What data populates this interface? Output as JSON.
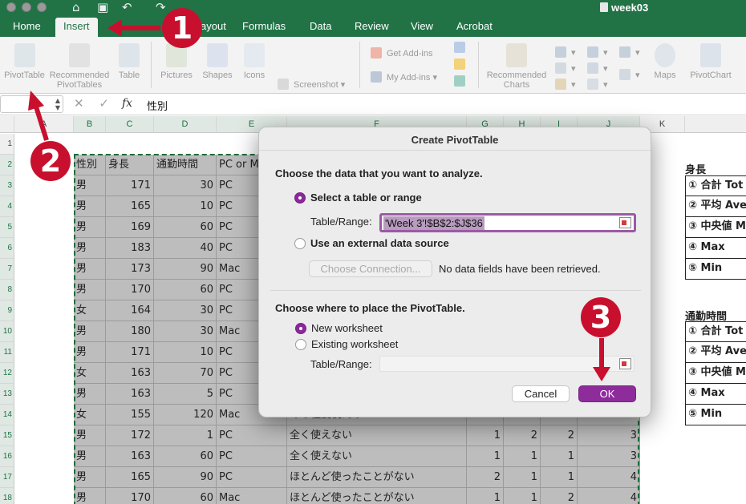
{
  "window": {
    "doc_title": "week03"
  },
  "tabs": [
    {
      "label": "Home",
      "active": false
    },
    {
      "label": "Insert",
      "active": true
    },
    {
      "label": "ayout",
      "active": false
    },
    {
      "label": "Formulas",
      "active": false
    },
    {
      "label": "Data",
      "active": false
    },
    {
      "label": "Review",
      "active": false
    },
    {
      "label": "View",
      "active": false
    },
    {
      "label": "Acrobat",
      "active": false
    }
  ],
  "ribbon": {
    "pivottable": "PivotTable",
    "recommended1": "Recommended",
    "recommended2": "PivotTables",
    "table": "Table",
    "pictures": "Pictures",
    "shapes": "Shapes",
    "icons": "Icons",
    "screenshot": "Screenshot",
    "get_addins": "Get Add-ins",
    "my_addins": "My Add-ins",
    "rec_charts1": "Recommended",
    "rec_charts2": "Charts",
    "maps": "Maps",
    "pivotchart": "PivotChart"
  },
  "formula_bar": {
    "fx": "fx",
    "value": "性別"
  },
  "columns": [
    "B",
    "C",
    "D",
    "E",
    "F",
    "G",
    "H",
    "I",
    "J",
    "K"
  ],
  "extra_col": "A",
  "rows": [
    "1",
    "2",
    "3",
    "4",
    "5",
    "6",
    "7",
    "8",
    "9",
    "10",
    "11",
    "12",
    "13",
    "14",
    "15",
    "16",
    "17",
    "18"
  ],
  "headers": {
    "b": "性別",
    "c": "身長",
    "d": "通勤時間",
    "e": "PC or M"
  },
  "data_rows": [
    {
      "b": "男",
      "c": "171",
      "d": "30",
      "e": "PC",
      "f": "",
      "g": "",
      "h": "",
      "i": "",
      "j": ""
    },
    {
      "b": "男",
      "c": "165",
      "d": "10",
      "e": "PC",
      "f": "",
      "g": "",
      "h": "",
      "i": "",
      "j": ""
    },
    {
      "b": "男",
      "c": "169",
      "d": "60",
      "e": "PC",
      "f": "",
      "g": "",
      "h": "",
      "i": "",
      "j": ""
    },
    {
      "b": "男",
      "c": "183",
      "d": "40",
      "e": "PC",
      "f": "",
      "g": "",
      "h": "",
      "i": "",
      "j": ""
    },
    {
      "b": "男",
      "c": "173",
      "d": "90",
      "e": "Mac",
      "f": "",
      "g": "",
      "h": "",
      "i": "",
      "j": ""
    },
    {
      "b": "男",
      "c": "170",
      "d": "60",
      "e": "PC",
      "f": "",
      "g": "",
      "h": "",
      "i": "",
      "j": ""
    },
    {
      "b": "女",
      "c": "164",
      "d": "30",
      "e": "PC",
      "f": "",
      "g": "",
      "h": "",
      "i": "",
      "j": ""
    },
    {
      "b": "男",
      "c": "180",
      "d": "30",
      "e": "Mac",
      "f": "",
      "g": "",
      "h": "",
      "i": "",
      "j": ""
    },
    {
      "b": "男",
      "c": "171",
      "d": "10",
      "e": "PC",
      "f": "",
      "g": "",
      "h": "",
      "i": "",
      "j": ""
    },
    {
      "b": "女",
      "c": "163",
      "d": "70",
      "e": "PC",
      "f": "",
      "g": "",
      "h": "",
      "i": "",
      "j": ""
    },
    {
      "b": "男",
      "c": "163",
      "d": "5",
      "e": "PC",
      "f": "",
      "g": "",
      "h": "",
      "i": "",
      "j": ""
    },
    {
      "b": "女",
      "c": "155",
      "d": "120",
      "e": "Mac",
      "f": "ある程度使える",
      "g": "2",
      "h": "2",
      "i": "2",
      "j": "3"
    },
    {
      "b": "男",
      "c": "172",
      "d": "1",
      "e": "PC",
      "f": "全く使えない",
      "g": "1",
      "h": "2",
      "i": "2",
      "j": "3"
    },
    {
      "b": "男",
      "c": "163",
      "d": "60",
      "e": "PC",
      "f": "全く使えない",
      "g": "1",
      "h": "1",
      "i": "1",
      "j": "3"
    },
    {
      "b": "男",
      "c": "165",
      "d": "90",
      "e": "PC",
      "f": "ほとんど使ったことがない",
      "g": "2",
      "h": "1",
      "i": "1",
      "j": "4"
    },
    {
      "b": "男",
      "c": "170",
      "d": "60",
      "e": "Mac",
      "f": "ほとんど使ったことがない",
      "g": "1",
      "h": "1",
      "i": "2",
      "j": "4"
    }
  ],
  "right_panel": {
    "title1": "身長",
    "items1": [
      "① 合計 Tot",
      "② 平均 Ave",
      "③ 中央値 M",
      "④ Max",
      "⑤ Min"
    ],
    "title2": "通勤時間",
    "items2": [
      "① 合計 Tot",
      "② 平均 Ave",
      "③ 中央値 M",
      "④ Max",
      "⑤ Min"
    ]
  },
  "dialog": {
    "title": "Create PivotTable",
    "section1": "Choose the data that you want to analyze.",
    "opt_select": "Select a table or range",
    "range_label": "Table/Range:",
    "range_value": "'Week 3'!$B$2:$J$36",
    "opt_external": "Use an external data source",
    "choose_conn": "Choose Connection...",
    "no_fields": "No data fields have been retrieved.",
    "section2": "Choose where to place the PivotTable.",
    "opt_new": "New worksheet",
    "opt_existing": "Existing worksheet",
    "range_label2": "Table/Range:",
    "range_value2": "",
    "cancel": "Cancel",
    "ok": "OK"
  },
  "annotations": {
    "n1": "1",
    "n2": "2",
    "n3": "3",
    "color": "#c8102e"
  },
  "colors": {
    "excel_green": "#217346",
    "accent_purple": "#8e2c9c"
  }
}
